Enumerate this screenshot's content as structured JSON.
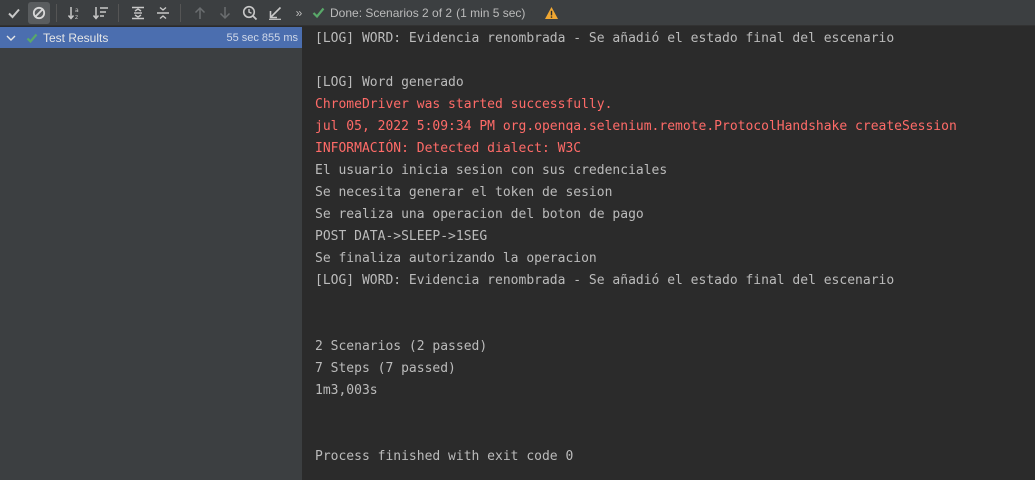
{
  "toolbar": {
    "status_text": "Done: Scenarios 2 of 2",
    "status_duration": "(1 min 5 sec)",
    "more_label": "»",
    "buttons": [
      {
        "name": "show-passed-icon"
      },
      {
        "name": "show-ignored-icon"
      },
      {
        "name": "sort-alphabetically-icon"
      },
      {
        "name": "sort-by-duration-icon"
      },
      {
        "name": "expand-all-icon"
      },
      {
        "name": "collapse-all-icon"
      },
      {
        "name": "previous-failed-icon"
      },
      {
        "name": "next-failed-icon"
      },
      {
        "name": "test-history-icon"
      },
      {
        "name": "import-tests-icon"
      }
    ]
  },
  "tree": {
    "root_label": "Test Results",
    "root_time": "55 sec 855 ms"
  },
  "console": {
    "lines": [
      {
        "text": "[LOG] WORD: Evidencia renombrada - Se añadió el estado final del escenario",
        "type": "normal"
      },
      {
        "text": "",
        "type": "normal"
      },
      {
        "text": "[LOG] Word generado",
        "type": "normal"
      },
      {
        "text": "ChromeDriver was started successfully.",
        "type": "error"
      },
      {
        "text": "jul 05, 2022 5:09:34 PM org.openqa.selenium.remote.ProtocolHandshake createSession",
        "type": "error"
      },
      {
        "text": "INFORMACIÓN: Detected dialect: W3C",
        "type": "error"
      },
      {
        "text": "El usuario inicia sesion con sus credenciales",
        "type": "normal"
      },
      {
        "text": "Se necesita generar el token de sesion",
        "type": "normal"
      },
      {
        "text": "Se realiza una operacion del boton de pago",
        "type": "normal"
      },
      {
        "text": "POST DATA->SLEEP->1SEG",
        "type": "normal"
      },
      {
        "text": "Se finaliza autorizando la operacion",
        "type": "normal"
      },
      {
        "text": "[LOG] WORD: Evidencia renombrada - Se añadió el estado final del escenario",
        "type": "normal"
      },
      {
        "text": "",
        "type": "normal"
      },
      {
        "text": "",
        "type": "normal"
      },
      {
        "text": "2 Scenarios (2 passed)",
        "type": "normal"
      },
      {
        "text": "7 Steps (7 passed)",
        "type": "normal"
      },
      {
        "text": "1m3,003s",
        "type": "normal"
      },
      {
        "text": "",
        "type": "normal"
      },
      {
        "text": "",
        "type": "normal"
      },
      {
        "text": "Process finished with exit code 0",
        "type": "normal"
      }
    ]
  },
  "colors": {
    "error_text": "#ff6b68",
    "normal_text": "#bbbbbb",
    "selection": "#4b6eaf",
    "pass_green": "#59a869",
    "warning_yellow": "#f0a732"
  }
}
